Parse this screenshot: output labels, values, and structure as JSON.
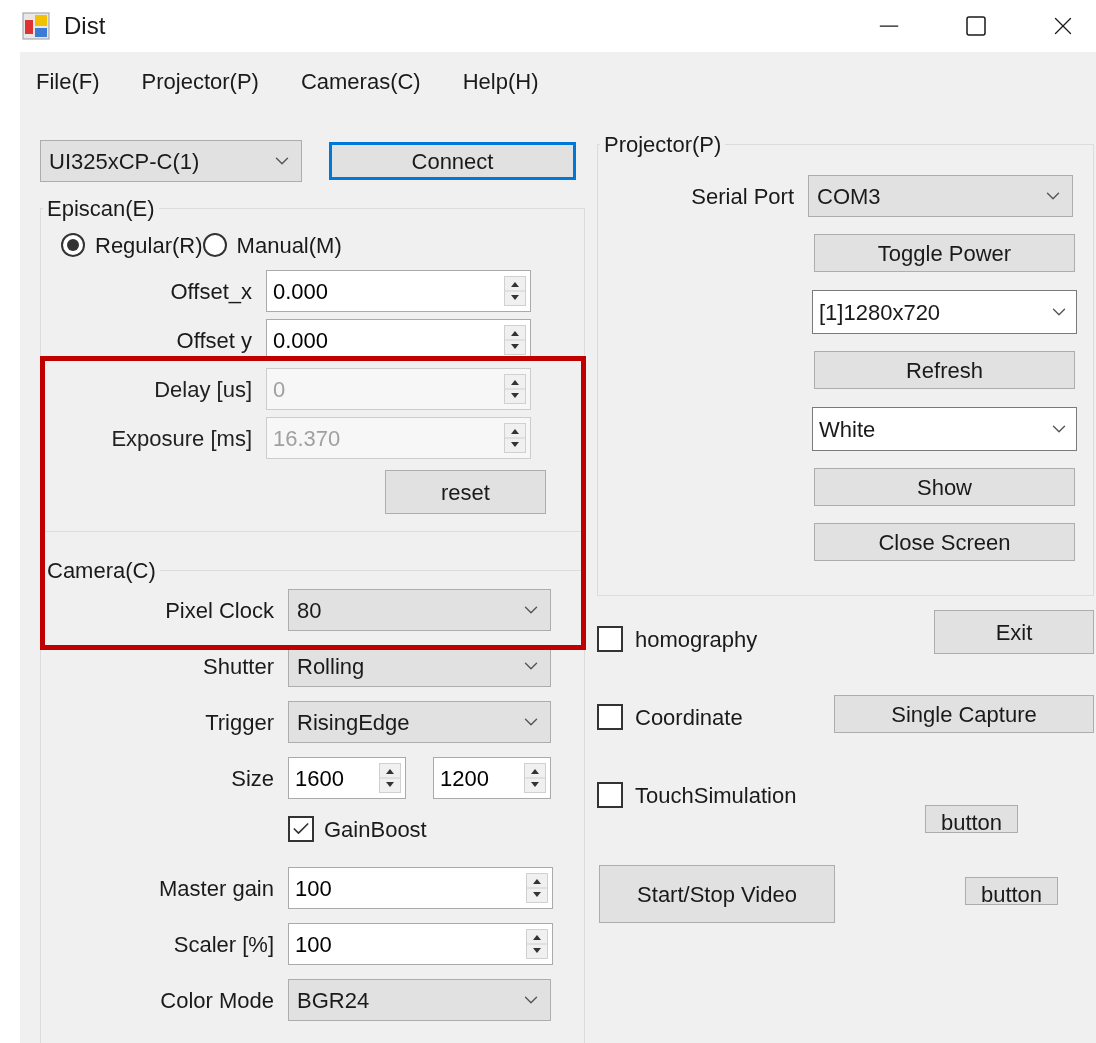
{
  "window": {
    "title": "Dist"
  },
  "menu": [
    {
      "label": "File(F)"
    },
    {
      "label": "Projector(P)"
    },
    {
      "label": "Cameras(C)"
    },
    {
      "label": "Help(H)"
    }
  ],
  "device": {
    "value": "UI325xCP-C(1)"
  },
  "connect_button": {
    "label": "Connect",
    "focused": true
  },
  "episcan": {
    "title": "Episcan(E)",
    "modes": [
      {
        "label": "Regular(R)",
        "selected": true
      },
      {
        "label": "Manual(M)",
        "selected": false
      }
    ],
    "fields": [
      {
        "label": "Offset_x",
        "value": "0.000",
        "disabled": false
      },
      {
        "label": "Offset y",
        "value": "0.000",
        "disabled": false
      },
      {
        "label": "Delay [us]",
        "value": "0",
        "disabled": true
      },
      {
        "label": "Exposure [ms]",
        "value": "16.370",
        "disabled": true
      }
    ],
    "reset_button": {
      "label": "reset"
    }
  },
  "camera": {
    "title": "Camera(C)",
    "rows": [
      {
        "kind": "combo",
        "label": "Pixel Clock",
        "value": "80"
      },
      {
        "kind": "combo",
        "label": "Shutter",
        "value": "Rolling"
      },
      {
        "kind": "combo",
        "label": "Trigger",
        "value": "RisingEdge"
      },
      {
        "kind": "size",
        "label": "Size",
        "values": [
          "1600",
          "1200"
        ]
      },
      {
        "kind": "checkbox",
        "label": "GainBoost",
        "checked": true
      },
      {
        "kind": "spin",
        "label": "Master gain",
        "value": "100"
      },
      {
        "kind": "spin",
        "label": "Scaler [%]",
        "value": "100"
      },
      {
        "kind": "combo",
        "label": "Color Mode",
        "value": "BGR24"
      }
    ]
  },
  "projector": {
    "title": "Projector(P)",
    "serial_port": {
      "label": "Serial Port",
      "value": "COM3"
    },
    "controls": [
      {
        "kind": "button",
        "label": "Toggle Power"
      },
      {
        "kind": "combo",
        "value": "[1]1280x720"
      },
      {
        "kind": "button",
        "label": "Refresh"
      },
      {
        "kind": "combo",
        "value": "White"
      },
      {
        "kind": "button",
        "label": "Show"
      },
      {
        "kind": "button",
        "label": "Close Screen"
      }
    ]
  },
  "side_rows": [
    {
      "checkbox": {
        "label": "homography",
        "checked": false
      },
      "button": {
        "label": "Exit",
        "kind": "large"
      }
    },
    {
      "checkbox": {
        "label": "Coordinate",
        "checked": false
      },
      "button": {
        "label": "Single Capture",
        "kind": "wide"
      }
    },
    {
      "checkbox": {
        "label": "TouchSimulation",
        "checked": false
      },
      "button": {
        "label": "button",
        "kind": "small"
      }
    },
    {
      "button_left": {
        "label": "Start/Stop Video"
      },
      "button": {
        "label": "button",
        "kind": "small"
      }
    }
  ],
  "highlight": {
    "kind": "frame"
  }
}
